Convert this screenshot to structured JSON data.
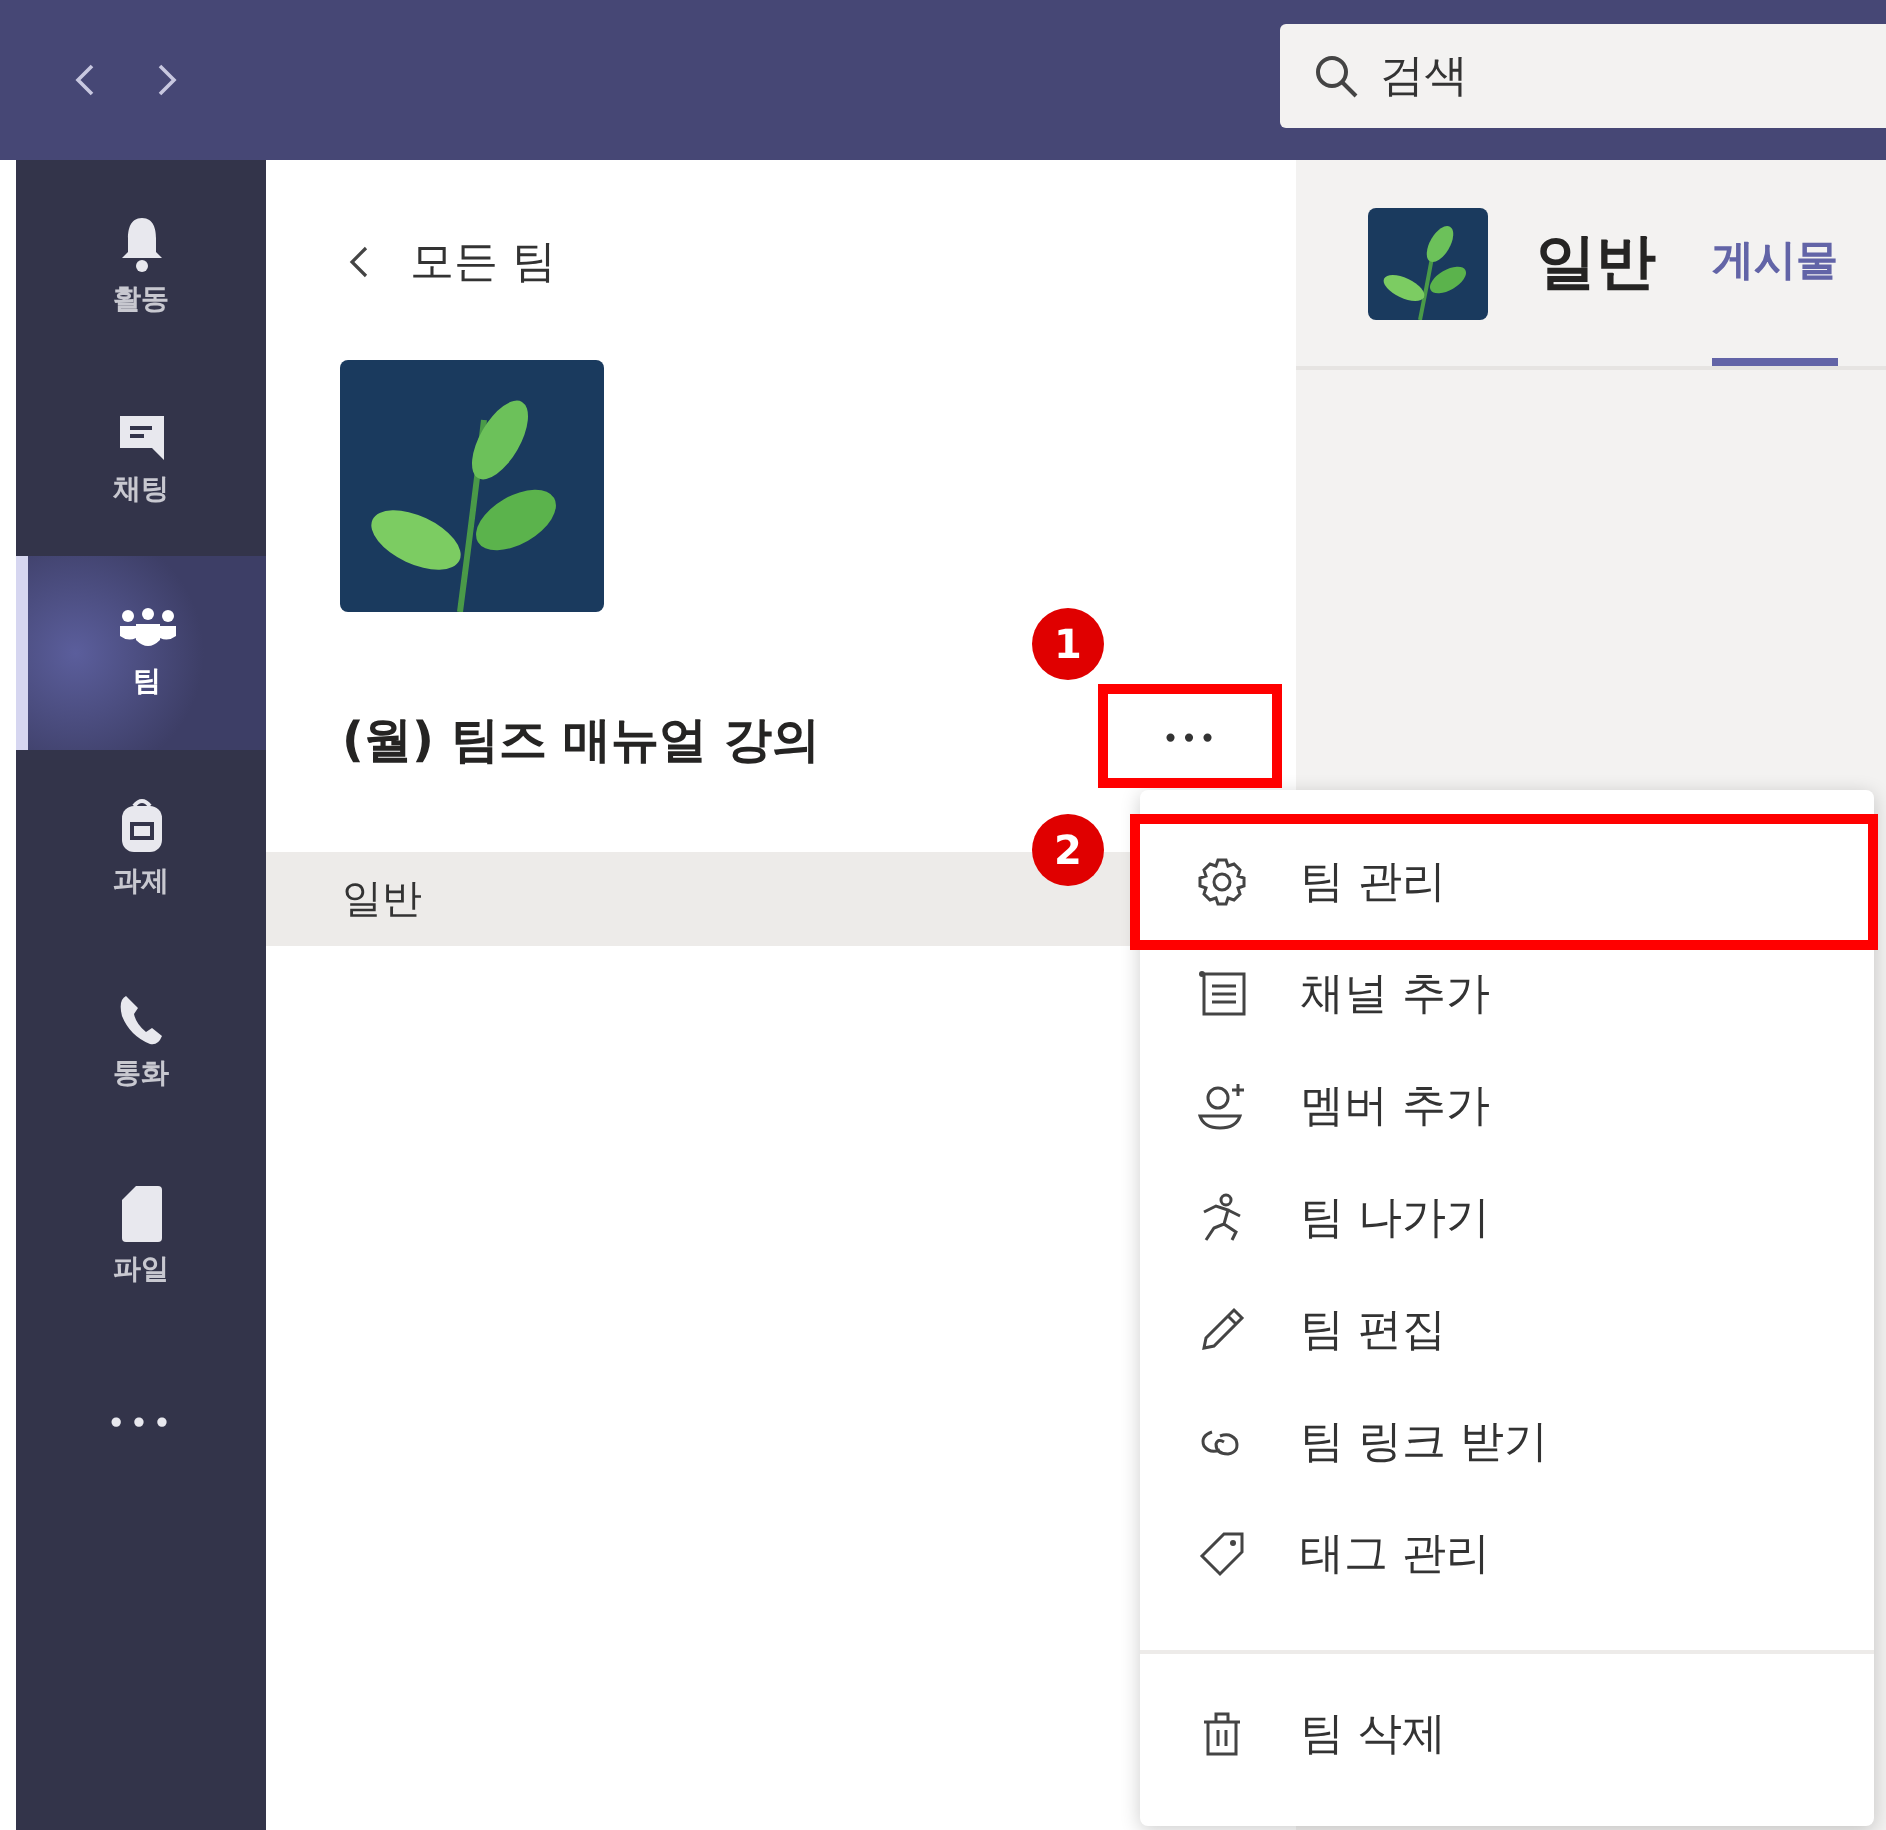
{
  "search": {
    "placeholder": "검색"
  },
  "rail": [
    {
      "label": "활동",
      "selected": false
    },
    {
      "label": "채팅",
      "selected": false
    },
    {
      "label": "팀",
      "selected": true
    },
    {
      "label": "과제",
      "selected": false
    },
    {
      "label": "통화",
      "selected": false
    },
    {
      "label": "파일",
      "selected": false
    }
  ],
  "rail_more": "•••",
  "team_panel": {
    "back_link": "모든 팀",
    "team_name": "(월) 팀즈 매뉴얼 강의",
    "more_button": "•••",
    "channels": [
      {
        "name": "일반",
        "selected": true
      }
    ]
  },
  "channel_header": {
    "title": "일반",
    "tabs": [
      {
        "label": "게시물",
        "selected": true
      }
    ]
  },
  "menu": {
    "groups": [
      [
        {
          "label": "팀 관리"
        },
        {
          "label": "채널 추가"
        },
        {
          "label": "멤버 추가"
        },
        {
          "label": "팀 나가기"
        },
        {
          "label": "팀 편집"
        },
        {
          "label": "팀 링크 받기"
        },
        {
          "label": "태그 관리"
        }
      ],
      [
        {
          "label": "팀 삭제"
        }
      ]
    ]
  },
  "annotations": [
    {
      "number": "1"
    },
    {
      "number": "2"
    }
  ]
}
